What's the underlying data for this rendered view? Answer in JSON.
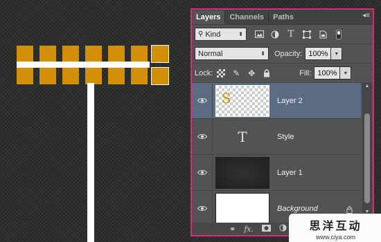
{
  "panel": {
    "tabs": [
      "Layers",
      "Channels",
      "Paths"
    ],
    "menu_icon": "panel-menu-icon",
    "filter": {
      "label": "Kind",
      "icons": [
        "image-filter-icon",
        "adjustment-filter-icon",
        "type-filter-icon",
        "shape-filter-icon",
        "smart-object-filter-icon",
        "filter-toggle-icon"
      ]
    },
    "blend_mode": "Normal",
    "opacity": {
      "label": "Opacity:",
      "value": "100%"
    },
    "lock": {
      "label": "Lock:",
      "icons": [
        "lock-transparent-icon",
        "lock-image-icon",
        "lock-position-icon",
        "lock-all-icon"
      ]
    },
    "fill": {
      "label": "Fill:",
      "value": "100%"
    },
    "layers": [
      {
        "name": "Layer 2",
        "selected": true,
        "visible": true
      },
      {
        "name": "Style",
        "selected": false,
        "visible": true
      },
      {
        "name": "Layer 1",
        "selected": false,
        "visible": true
      },
      {
        "name": "Background",
        "selected": false,
        "visible": true,
        "locked": true
      }
    ],
    "type_glyph": "T",
    "footer_icons": [
      "link-layers-icon",
      "fx-icon",
      "layer-mask-icon",
      "adjustment-layer-icon"
    ],
    "footer_fx": "fx."
  },
  "watermark": {
    "title": "思洋互动",
    "url": "www.ciya.com"
  },
  "colors": {
    "accent_border": "#e0277d",
    "selection": "#5b6b82",
    "canvas_square": "#d38f0a",
    "panel_bg": "#535353"
  }
}
